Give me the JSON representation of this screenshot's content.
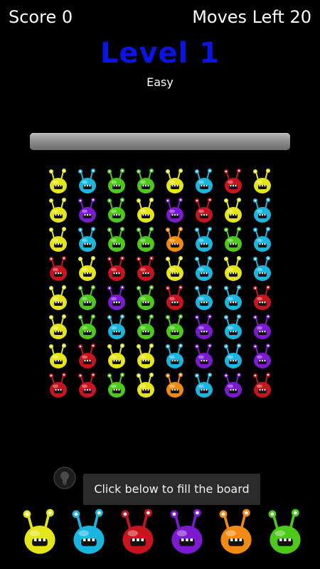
{
  "header": {
    "score_label": "Score 0",
    "moves_label": "Moves Left 20"
  },
  "level": {
    "title": "Level 1",
    "difficulty": "Easy"
  },
  "progress": {
    "fraction": 0
  },
  "colors": {
    "yellow": "#e4e61a",
    "cyan": "#1ab6e0",
    "green": "#4cc91a",
    "red": "#c8141e",
    "purple": "#7b1ad0",
    "orange": "#f08a12"
  },
  "board": {
    "rows": [
      [
        "yellow",
        "cyan",
        "green",
        "green",
        "yellow",
        "cyan",
        "red",
        "yellow"
      ],
      [
        "yellow",
        "purple",
        "green",
        "yellow",
        "purple",
        "red",
        "yellow",
        "cyan"
      ],
      [
        "yellow",
        "cyan",
        "green",
        "green",
        "orange",
        "cyan",
        "green",
        "cyan"
      ],
      [
        "red",
        "yellow",
        "red",
        "red",
        "yellow",
        "cyan",
        "yellow",
        "cyan"
      ],
      [
        "yellow",
        "green",
        "purple",
        "green",
        "red",
        "cyan",
        "cyan",
        "red"
      ],
      [
        "yellow",
        "green",
        "cyan",
        "green",
        "green",
        "purple",
        "cyan",
        "purple"
      ],
      [
        "yellow",
        "red",
        "yellow",
        "yellow",
        "cyan",
        "purple",
        "cyan",
        "purple"
      ],
      [
        "red",
        "red",
        "green",
        "yellow",
        "orange",
        "cyan",
        "purple",
        "red"
      ]
    ]
  },
  "hint": {
    "icon": "lightbulb-icon"
  },
  "toast": {
    "text": "Click below to fill the board"
  },
  "palette": {
    "items": [
      "yellow",
      "cyan",
      "red",
      "purple",
      "orange",
      "green"
    ]
  }
}
